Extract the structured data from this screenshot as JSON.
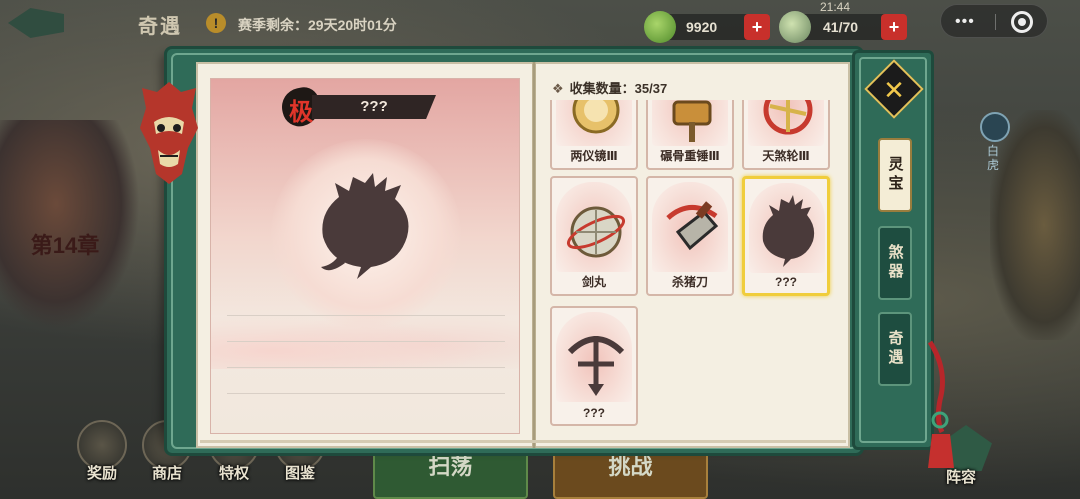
{
  "top": {
    "title": "奇遇",
    "season_remaining": "赛季剩余：29天20时01分",
    "jade": "9920",
    "stamina": "41/70",
    "time": "21:44",
    "plus_label": "+",
    "more_label": "•••"
  },
  "background": {
    "chapter": "第14章",
    "white_tiger": "白虎"
  },
  "detail": {
    "rank": "极",
    "name": "???"
  },
  "collection": {
    "count_label": "收集数量：35/37",
    "items": [
      {
        "name": "两仪镜Ⅲ",
        "icon": "mirror-icon"
      },
      {
        "name": "碾骨重锤Ⅲ",
        "icon": "hammer-icon"
      },
      {
        "name": "天煞轮Ⅲ",
        "icon": "wheel-icon"
      },
      {
        "name": "剑丸",
        "icon": "sword-orb-icon"
      },
      {
        "name": "杀猪刀",
        "icon": "cleaver-icon"
      },
      {
        "name": "???",
        "icon": "unknown-silhouette-icon"
      },
      {
        "name": "???",
        "icon": "unknown-crossbow-icon"
      }
    ]
  },
  "tabs": [
    {
      "label": "灵宝",
      "active": true
    },
    {
      "label": "煞器",
      "active": false
    },
    {
      "label": "奇遇",
      "active": false
    }
  ],
  "close_label": "✕",
  "bottom": {
    "nav": [
      {
        "label": "奖励"
      },
      {
        "label": "商店"
      },
      {
        "label": "特权"
      },
      {
        "label": "图鉴"
      }
    ],
    "sweep_label": "扫荡",
    "challenge_label": "挑战",
    "formation_label": "阵容"
  },
  "colors": {
    "frame_green": "#2f6b58",
    "selected_gold": "#f0cd3c",
    "rank_red": "#e0352a",
    "plus_red": "#c8302b"
  }
}
